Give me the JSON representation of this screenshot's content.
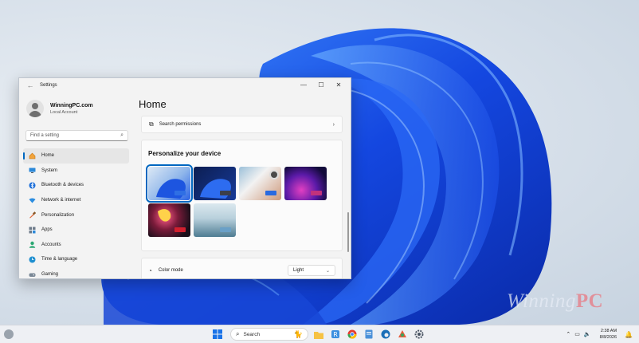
{
  "window": {
    "title": "Settings",
    "back": "←",
    "minimize": "—",
    "maximize": "☐",
    "close": "✕"
  },
  "account": {
    "name": "WinningPC.com",
    "type": "Local Account"
  },
  "search": {
    "placeholder": "Find a setting"
  },
  "sidebar": {
    "items": [
      {
        "label": "Home",
        "icon": "home-icon"
      },
      {
        "label": "System",
        "icon": "system-icon"
      },
      {
        "label": "Bluetooth & devices",
        "icon": "bluetooth-icon"
      },
      {
        "label": "Network & internet",
        "icon": "wifi-icon"
      },
      {
        "label": "Personalization",
        "icon": "brush-icon"
      },
      {
        "label": "Apps",
        "icon": "apps-icon"
      },
      {
        "label": "Accounts",
        "icon": "accounts-icon"
      },
      {
        "label": "Time & language",
        "icon": "globe-clock-icon"
      },
      {
        "label": "Gaming",
        "icon": "gaming-icon"
      }
    ]
  },
  "main": {
    "title": "Home",
    "search_permissions": "Search permissions",
    "personalize_heading": "Personalize your device",
    "color_mode_label": "Color mode",
    "color_mode_value": "Light"
  },
  "watermark": {
    "part1": "Winning",
    "part2": "PC"
  },
  "taskbar": {
    "search_placeholder": "Search",
    "time": "2:38 AM",
    "date": "8/8/2026"
  },
  "colors": {
    "accent": "#0067c0",
    "wallpaper_blue": "#1a56e8"
  }
}
